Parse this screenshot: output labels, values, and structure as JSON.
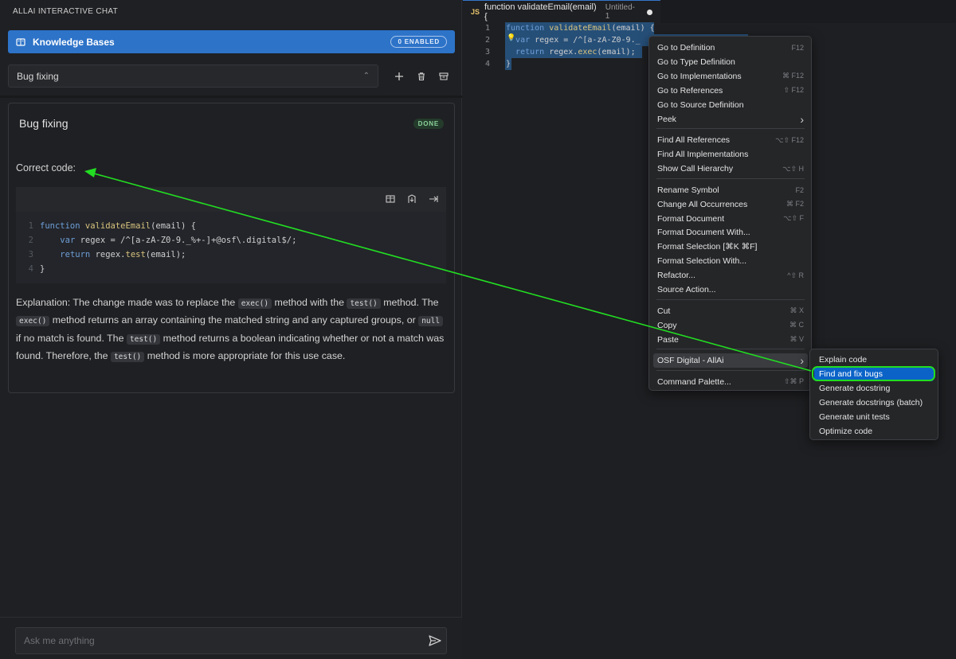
{
  "chat": {
    "title": "ALLAI INTERACTIVE CHAT",
    "knowledge_bases": {
      "label": "Knowledge Bases",
      "badge": "0 ENABLED",
      "icon": "book-icon"
    },
    "session_select": {
      "value": "Bug fixing"
    },
    "toolbar_icons": [
      "plus-icon",
      "trash-icon",
      "archive-icon"
    ],
    "card": {
      "title": "Bug fixing",
      "status": "DONE",
      "correct_label": "Correct code:",
      "code_toolbar_icons": [
        "split-view-icon",
        "insert-icon",
        "arrow-right-icon"
      ],
      "code_lines": [
        {
          "n": "1",
          "parts": [
            [
              "kw",
              "function "
            ],
            [
              "fn",
              "validateEmail"
            ],
            [
              "tx",
              "(email) {"
            ]
          ]
        },
        {
          "n": "2",
          "parts": [
            [
              "tx",
              "    "
            ],
            [
              "kw",
              "var "
            ],
            [
              "tx",
              "regex = /^[a-zA-Z0-9._%+-]+@osf\\.digital$/;"
            ]
          ]
        },
        {
          "n": "3",
          "parts": [
            [
              "tx",
              "    "
            ],
            [
              "kw",
              "return "
            ],
            [
              "tx",
              "regex."
            ],
            [
              "fn",
              "test"
            ],
            [
              "tx",
              "(email);"
            ]
          ]
        },
        {
          "n": "4",
          "parts": [
            [
              "tx",
              "}"
            ]
          ]
        }
      ],
      "explanation": {
        "t1": "Explanation: The change made was to replace the ",
        "c1": "exec()",
        "t2": " method with the ",
        "c2": "test()",
        "t3": " method. The ",
        "c3": "exec()",
        "t4": " method returns an array containing the matched string and any captured groups, or ",
        "c4": "null",
        "t5": " if no match is found. The ",
        "c5": "test()",
        "t6": " method returns a boolean indicating whether or not a match was found. Therefore, the ",
        "c6": "test()",
        "t7": " method is more appropriate for this use case."
      }
    },
    "input": {
      "placeholder": "Ask me anything",
      "send_icon": "send-icon"
    }
  },
  "editor": {
    "tab": {
      "lang": "JS",
      "name": "function validateEmail(email) {",
      "file": "Untitled-1"
    },
    "lines": [
      {
        "n": "1",
        "parts": [
          [
            "kw",
            "function "
          ],
          [
            "fn",
            "validateEmail"
          ],
          [
            "tx",
            "(email) {"
          ]
        ]
      },
      {
        "n": "2",
        "parts": [
          [
            "tx",
            "  "
          ],
          [
            "kw",
            "var "
          ],
          [
            "tx",
            "regex = /^"
          ],
          [
            "rx",
            "[a-zA-Z0-9._"
          ]
        ]
      },
      {
        "n": "3",
        "parts": [
          [
            "tx",
            "  "
          ],
          [
            "kw",
            "return "
          ],
          [
            "tx",
            "regex."
          ],
          [
            "fn",
            "exec"
          ],
          [
            "tx",
            "(email);"
          ]
        ]
      },
      {
        "n": "4",
        "parts": [
          [
            "tx",
            "}"
          ]
        ]
      }
    ]
  },
  "context_menu": {
    "groups": [
      [
        {
          "label": "Go to Definition",
          "shortcut": "F12"
        },
        {
          "label": "Go to Type Definition",
          "shortcut": ""
        },
        {
          "label": "Go to Implementations",
          "shortcut": "⌘ F12"
        },
        {
          "label": "Go to References",
          "shortcut": "⇧ F12"
        },
        {
          "label": "Go to Source Definition",
          "shortcut": ""
        },
        {
          "label": "Peek",
          "shortcut": "",
          "submenu": true
        }
      ],
      [
        {
          "label": "Find All References",
          "shortcut": "⌥⇧ F12"
        },
        {
          "label": "Find All Implementations",
          "shortcut": ""
        },
        {
          "label": "Show Call Hierarchy",
          "shortcut": "⌥⇧ H"
        }
      ],
      [
        {
          "label": "Rename Symbol",
          "shortcut": "F2"
        },
        {
          "label": "Change All Occurrences",
          "shortcut": "⌘ F2"
        },
        {
          "label": "Format Document",
          "shortcut": "⌥⇧ F"
        },
        {
          "label": "Format Document With...",
          "shortcut": ""
        },
        {
          "label": "Format Selection [⌘K ⌘F]",
          "shortcut": ""
        },
        {
          "label": "Format Selection With...",
          "shortcut": ""
        },
        {
          "label": "Refactor...",
          "shortcut": "^⇧ R"
        },
        {
          "label": "Source Action...",
          "shortcut": ""
        }
      ],
      [
        {
          "label": "Cut",
          "shortcut": "⌘ X"
        },
        {
          "label": "Copy",
          "shortcut": "⌘ C"
        },
        {
          "label": "Paste",
          "shortcut": "⌘ V"
        }
      ],
      [
        {
          "label": "OSF Digital - AllAi",
          "shortcut": "",
          "submenu": true,
          "active": true
        }
      ],
      [
        {
          "label": "Command Palette...",
          "shortcut": "⇧⌘ P"
        }
      ]
    ]
  },
  "submenu": {
    "items": [
      "Explain code",
      "Find and fix bugs",
      "Generate docstring",
      "Generate docstrings (batch)",
      "Generate unit tests",
      "Optimize code"
    ],
    "highlighted": 1
  },
  "annotation": {
    "color": "#22dd22"
  }
}
